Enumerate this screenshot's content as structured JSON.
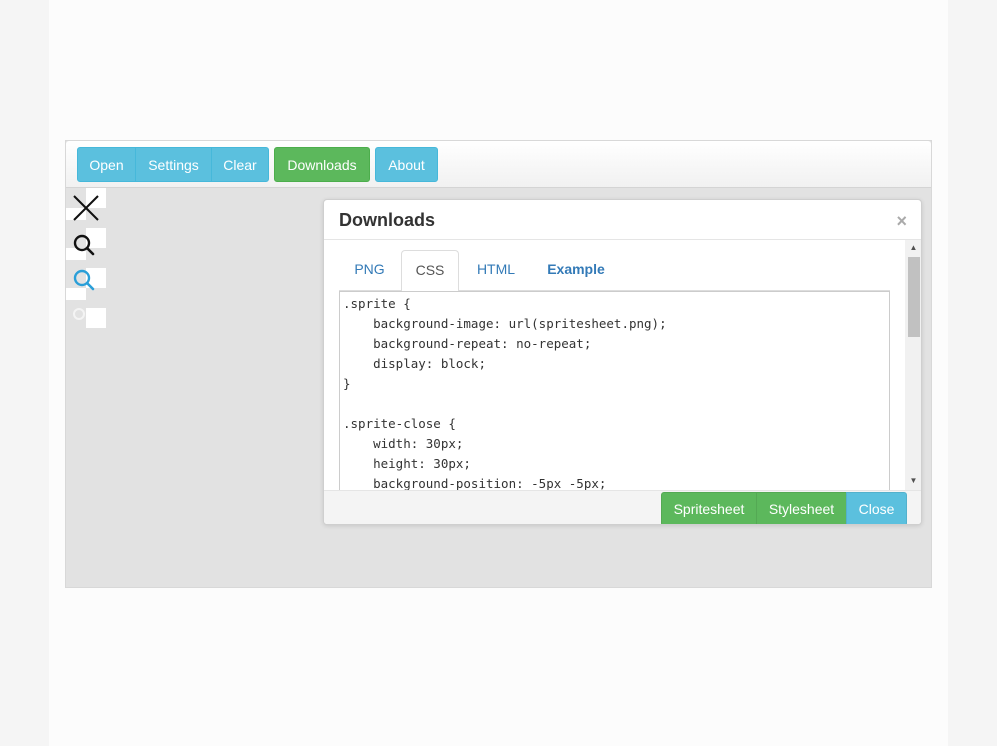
{
  "toolbar": {
    "open_label": "Open",
    "settings_label": "Settings",
    "clear_label": "Clear",
    "downloads_label": "Downloads",
    "about_label": "About"
  },
  "sprites": [
    {
      "icon": "close-icon",
      "color": "#111111"
    },
    {
      "icon": "search-icon",
      "color": "#111111"
    },
    {
      "icon": "search-icon",
      "color": "#2a9fd8"
    },
    {
      "icon": "search-icon",
      "color": "#e8e8e8"
    }
  ],
  "modal": {
    "title": "Downloads",
    "close_symbol": "×",
    "tabs": [
      {
        "label": "PNG"
      },
      {
        "label": "CSS"
      },
      {
        "label": "HTML"
      },
      {
        "label": "Example"
      }
    ],
    "active_tab": "CSS",
    "code_lines": [
      ".sprite {",
      "    background-image: url(spritesheet.png);",
      "    background-repeat: no-repeat;",
      "    display: block;",
      "}",
      "",
      ".sprite-close {",
      "    width: 30px;",
      "    height: 30px;",
      "    background-position: -5px -5px;"
    ],
    "footer": {
      "spritesheet_label": "Spritesheet",
      "stylesheet_label": "Stylesheet",
      "close_label": "Close"
    }
  },
  "colors": {
    "info": "#5bc0de",
    "success": "#5cb85c",
    "link": "#337ab7"
  }
}
